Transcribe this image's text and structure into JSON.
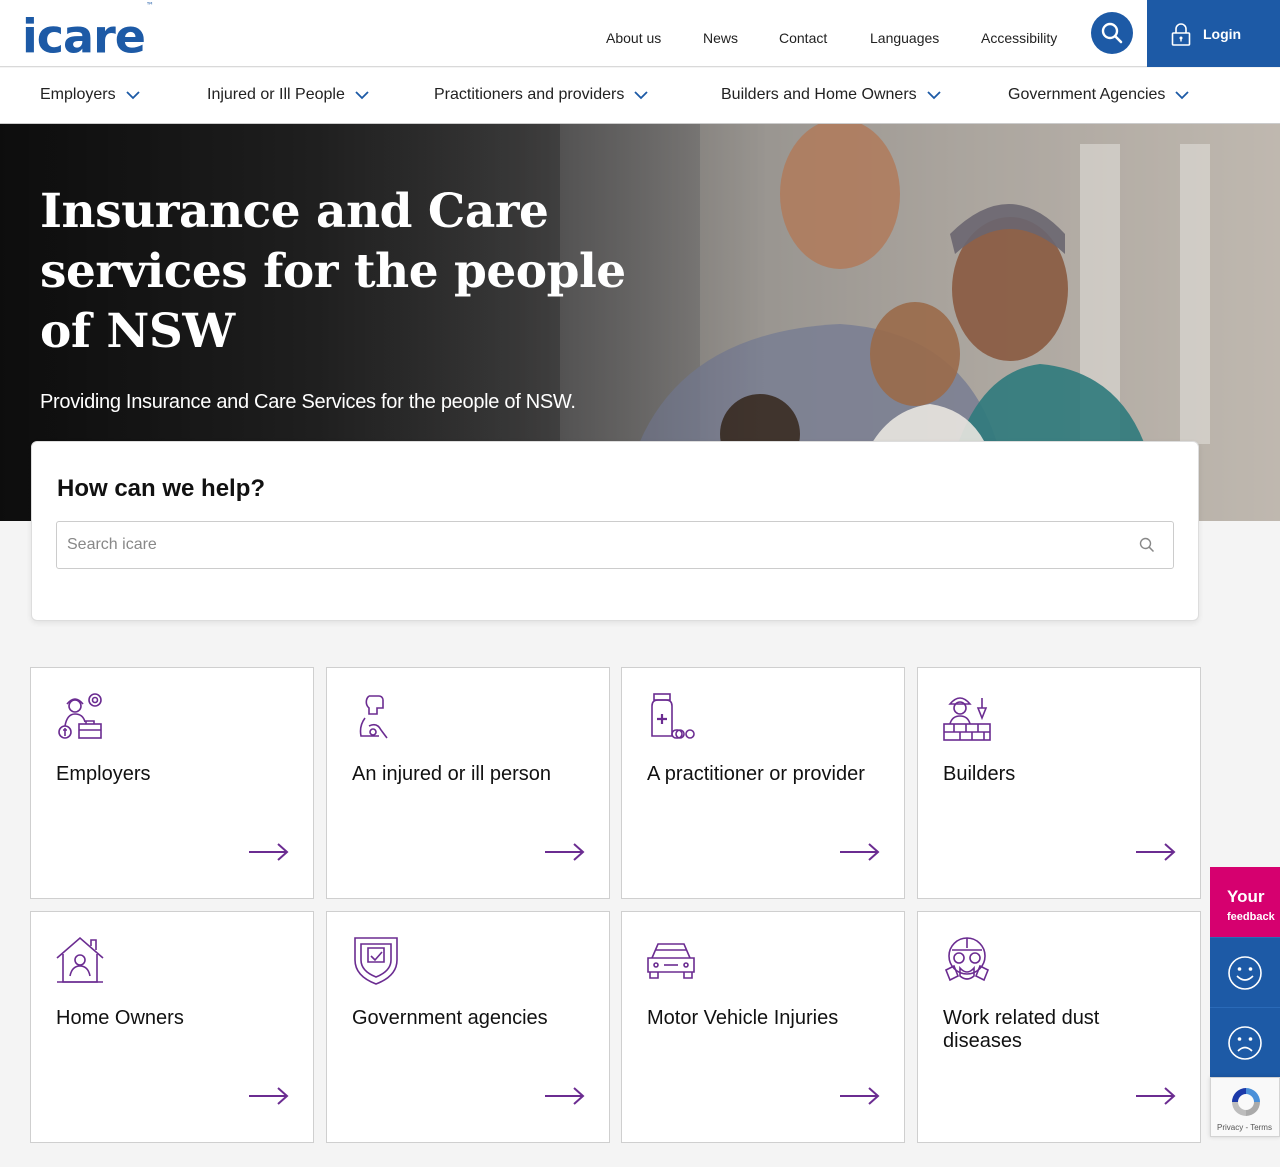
{
  "header": {
    "logo_text": "icare",
    "logo_tm": "™",
    "util_links": [
      "About us",
      "News",
      "Contact",
      "Languages",
      "Accessibility"
    ],
    "login_label": "Login"
  },
  "nav": {
    "items": [
      "Employers",
      "Injured or Ill People",
      "Practitioners and providers",
      "Builders and Home Owners",
      "Government Agencies"
    ]
  },
  "hero": {
    "title": "Insurance and Care services for the people of NSW",
    "subtitle": "Providing Insurance and Care Services for the people of NSW."
  },
  "help": {
    "heading": "How can we help?",
    "search_placeholder": "Search icare"
  },
  "cards": [
    {
      "title": "Employers",
      "icon": "employer-icon"
    },
    {
      "title": "An injured or ill person",
      "icon": "injured-person-icon"
    },
    {
      "title": "A practitioner or provider",
      "icon": "medicine-icon"
    },
    {
      "title": "Builders",
      "icon": "builder-icon"
    },
    {
      "title": "Home Owners",
      "icon": "home-owner-icon"
    },
    {
      "title": "Government agencies",
      "icon": "shield-icon"
    },
    {
      "title": "Motor Vehicle Injuries",
      "icon": "car-icon"
    },
    {
      "title": "Work related dust diseases",
      "icon": "respirator-icon"
    }
  ],
  "feedback": {
    "label_big": "Your",
    "label_small": "feedback"
  },
  "recaptcha": {
    "text": "Privacy - Terms"
  },
  "colors": {
    "brand_blue": "#1d5aa6",
    "accent_purple": "#6b2c91",
    "feedback_pink": "#d6006f"
  }
}
